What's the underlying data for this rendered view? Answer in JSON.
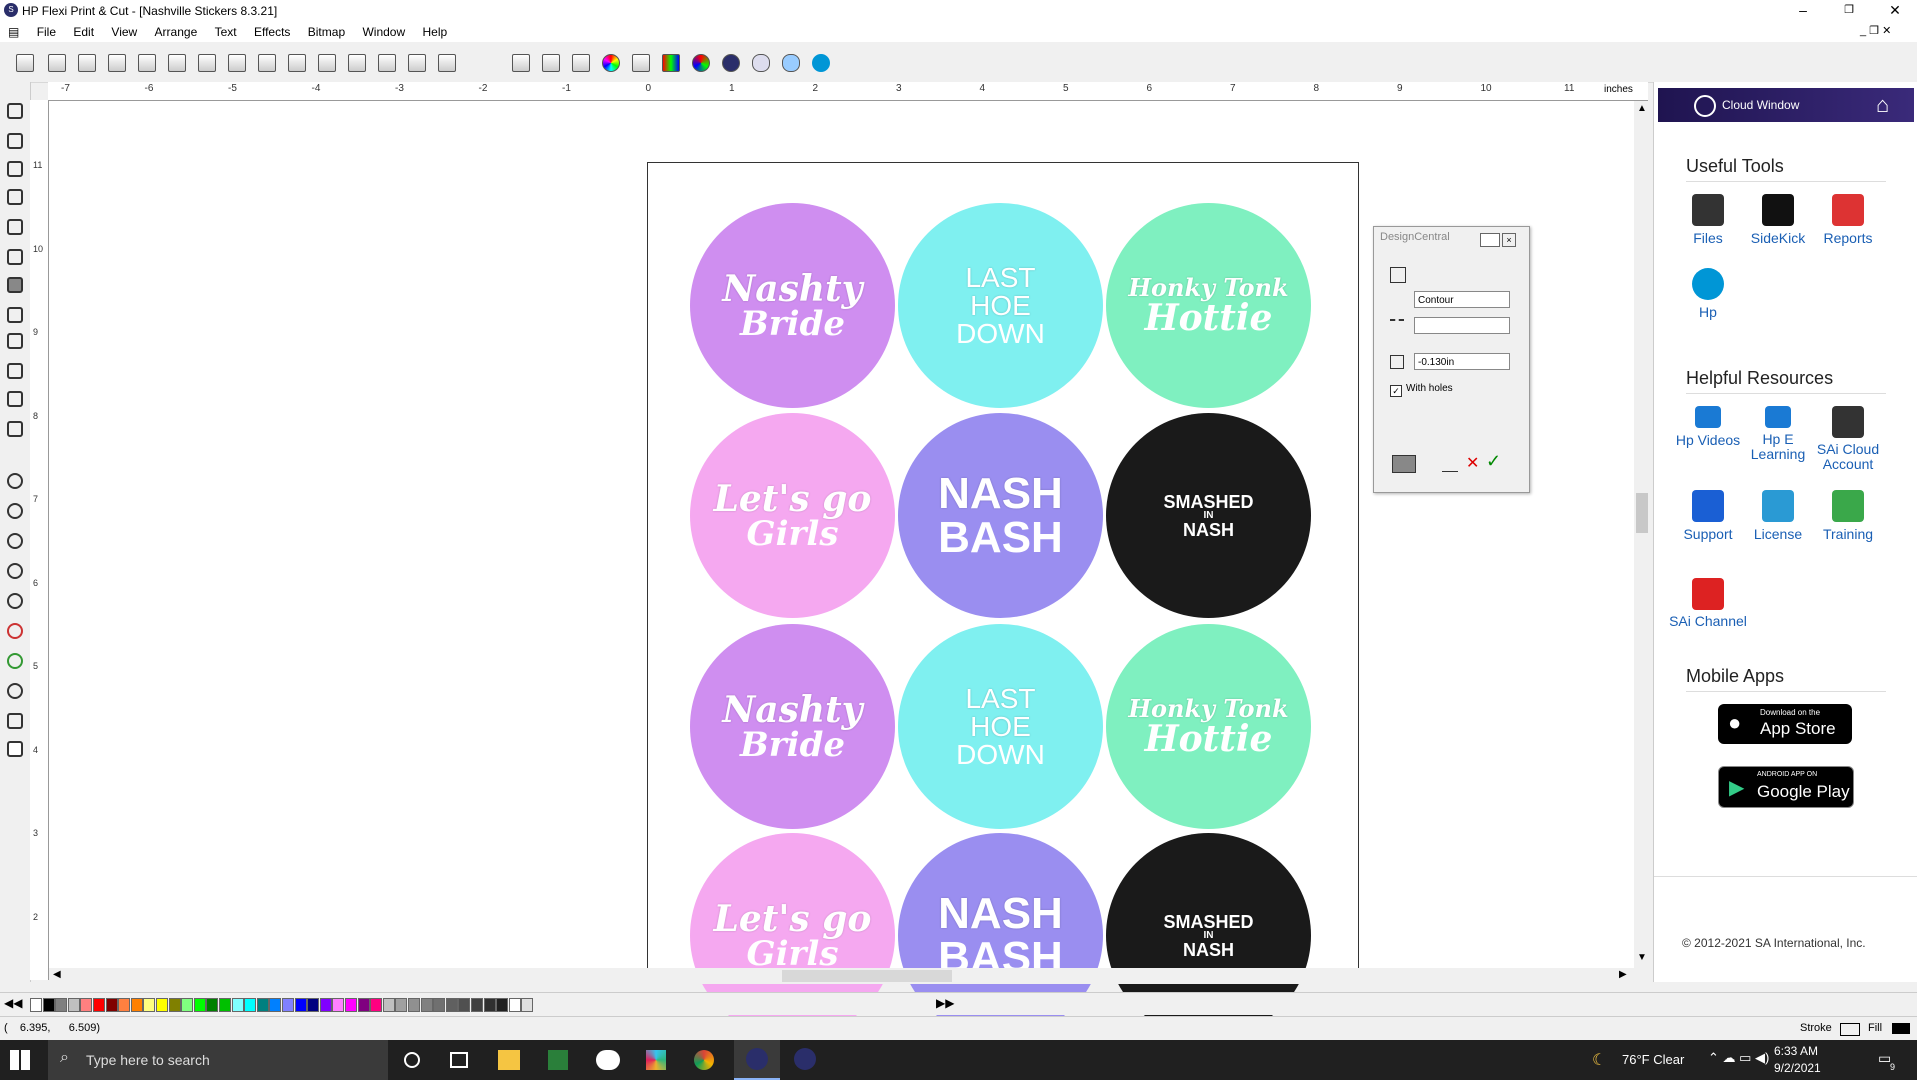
{
  "window": {
    "title": "HP Flexi Print & Cut - [Nashville Stickers 8.3.21]",
    "minimize": "–",
    "restore": "❐",
    "close": "✕"
  },
  "menu": [
    "File",
    "Edit",
    "View",
    "Arrange",
    "Text",
    "Effects",
    "Bitmap",
    "Window",
    "Help"
  ],
  "ruler": {
    "unit": "inches",
    "h_labels": [
      "-7",
      "-6",
      "-5",
      "-4",
      "-3",
      "-2",
      "-1",
      "0",
      "1",
      "2",
      "3",
      "4",
      "5",
      "6",
      "7",
      "8",
      "9",
      "10",
      "11"
    ],
    "v_labels": [
      "11",
      "10",
      "9",
      "8",
      "7",
      "6",
      "5",
      "4",
      "3",
      "2"
    ]
  },
  "stickers": [
    {
      "name": "nashty-bride",
      "top": "Nashty",
      "bottom": "Bride",
      "bg": "#cf8ef0"
    },
    {
      "name": "last-hoe-down",
      "top": "LAST",
      "mid": "HOE",
      "bottom": "DOWN",
      "bg": "#7ff0f0"
    },
    {
      "name": "honky-tonk-hottie",
      "top": "Honky Tonk",
      "bottom": "Hottie",
      "bg": "#7ff0c0"
    },
    {
      "name": "lets-go-girls",
      "top": "Let's go",
      "bottom": "Girls",
      "bg": "#f5a8f0"
    },
    {
      "name": "nash-bash",
      "top": "NASH",
      "bottom": "BASH",
      "bg": "#9a8ef0"
    },
    {
      "name": "smashed-in-nash",
      "top": "SMASHED",
      "mid": "IN",
      "bottom": "NASH",
      "bg": "#1a1a1a"
    },
    {
      "name": "nashty-bride-2",
      "top": "Nashty",
      "bottom": "Bride",
      "bg": "#cf8ef0"
    },
    {
      "name": "last-hoe-down-2",
      "top": "LAST",
      "mid": "HOE",
      "bottom": "DOWN",
      "bg": "#7ff0f0"
    },
    {
      "name": "honky-tonk-hottie-2",
      "top": "Honky Tonk",
      "bottom": "Hottie",
      "bg": "#7ff0c0"
    },
    {
      "name": "lets-go-girls-2",
      "top": "Let's go",
      "bottom": "Girls",
      "bg": "#f5a8f0"
    },
    {
      "name": "nash-bash-2",
      "top": "NASH",
      "bottom": "BASH",
      "bg": "#9a8ef0"
    },
    {
      "name": "smashed-in-nash-2",
      "top": "SMASHED",
      "mid": "IN",
      "bottom": "NASH",
      "bg": "#1a1a1a"
    }
  ],
  "design_central": {
    "title": "DesignCentral",
    "mode": "Contour",
    "offset": "-0.130in",
    "with_holes": "With holes"
  },
  "right_panel": {
    "cloud_title": "Cloud Window",
    "useful_tools_title": "Useful Tools",
    "useful_tools": [
      {
        "label": "Files",
        "icon": "files-icon",
        "color": "#333"
      },
      {
        "label": "SideKick",
        "icon": "sidekick-icon",
        "color": "#111"
      },
      {
        "label": "Reports",
        "icon": "reports-icon",
        "color": "#d33"
      },
      {
        "label": "Hp",
        "icon": "hp-icon",
        "color": "#0096d6"
      }
    ],
    "helpful_title": "Helpful Resources",
    "helpful": [
      {
        "label": "Hp Videos",
        "icon": "video-icon",
        "color": "#1a7ad4"
      },
      {
        "label": "Hp E Learning",
        "icon": "elearning-icon",
        "color": "#1a7ad4"
      },
      {
        "label": "SAi Cloud Account",
        "icon": "cloud-account-icon",
        "color": "#333"
      },
      {
        "label": "Support",
        "icon": "support-icon",
        "color": "#1a5fd4"
      },
      {
        "label": "License",
        "icon": "license-icon",
        "color": "#2a9ad4"
      },
      {
        "label": "Training",
        "icon": "training-icon",
        "color": "#3aa84a"
      },
      {
        "label": "SAi Channel",
        "icon": "youtube-icon",
        "color": "#d22"
      }
    ],
    "mobile_title": "Mobile Apps",
    "app_store_small": "Download on the",
    "app_store": "App Store",
    "google_small": "ANDROID APP ON",
    "google": "Google Play",
    "copyright": "© 2012-2021 SA International, Inc."
  },
  "status": {
    "coords": "(    6.395,      6.509)",
    "stroke": "Stroke",
    "fill": "Fill"
  },
  "taskbar": {
    "search": "Type here to search",
    "weather": "76°F  Clear",
    "time": "6:33 AM",
    "date": "9/2/2021",
    "notif": "9"
  },
  "palette": [
    "#ffffff",
    "#000000",
    "#7f7f7f",
    "#c0c0c0",
    "#ff8080",
    "#ff0000",
    "#800000",
    "#ff8040",
    "#ff8000",
    "#ffff80",
    "#ffff00",
    "#808000",
    "#80ff80",
    "#00ff00",
    "#008000",
    "#00c000",
    "#80ffff",
    "#00ffff",
    "#008080",
    "#0080ff",
    "#8080ff",
    "#0000ff",
    "#000080",
    "#8000ff",
    "#ff80ff",
    "#ff00ff",
    "#800080",
    "#ff0080",
    "#c0c0c0",
    "#a0a0a0",
    "#909090",
    "#808080",
    "#707070",
    "#606060",
    "#505050",
    "#404040",
    "#303030",
    "#202020",
    "#ffffff",
    "#e0e0e0"
  ]
}
